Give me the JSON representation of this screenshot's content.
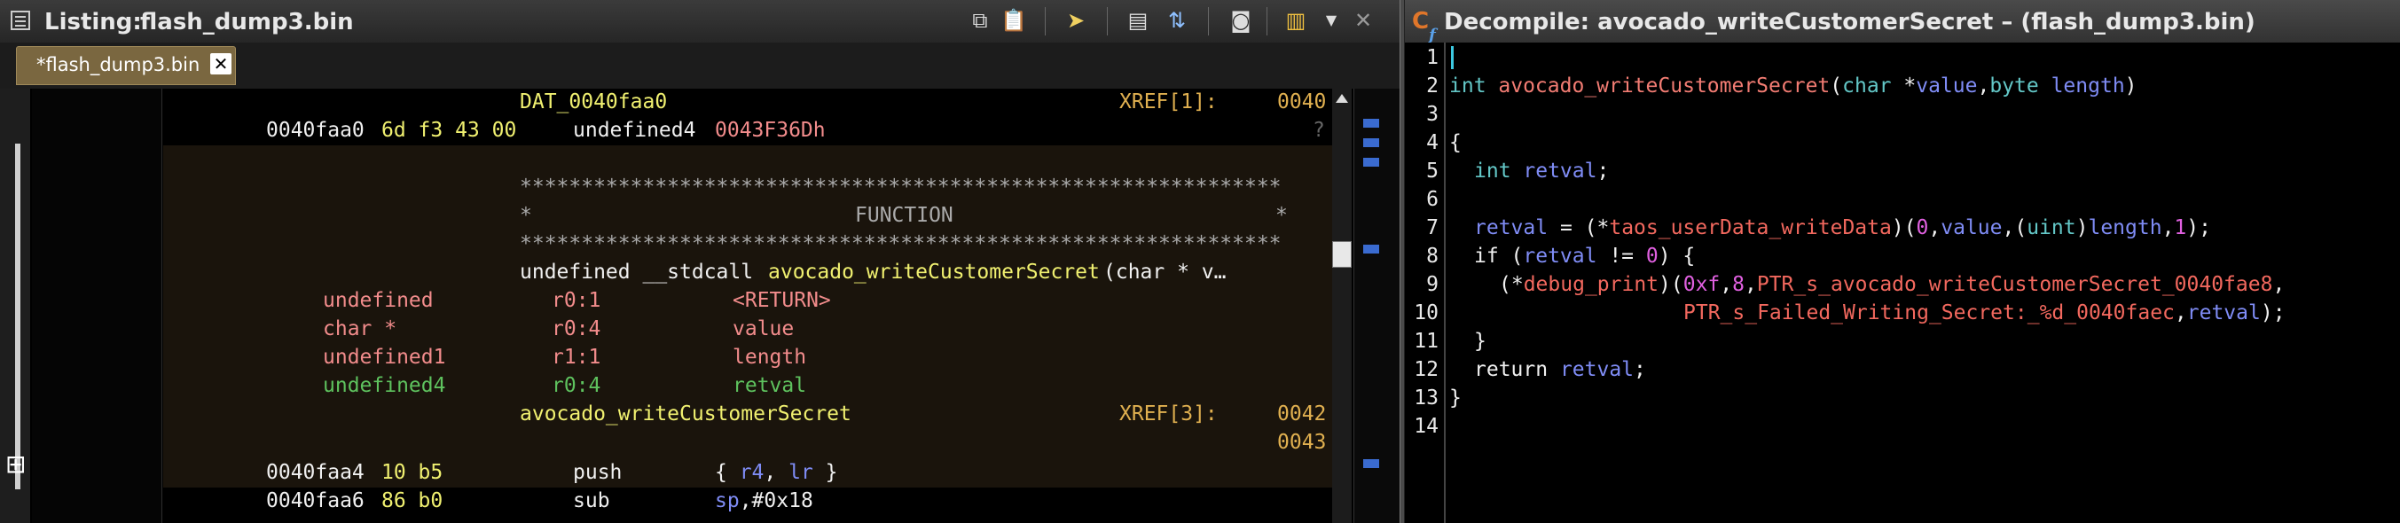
{
  "listing": {
    "title_prefix": "Listing:",
    "title_file": "flash_dump3.bin",
    "tab_label": "*flash_dump3.bin",
    "tab_close": "✕",
    "lines": {
      "dat_label": "DAT_0040faa0",
      "xref1_label": "XREF[1]:",
      "xref1_addr": "0040",
      "data_addr": "0040faa0",
      "data_bytes": "6d f3 43 00",
      "data_type": "undefined4",
      "data_value": "0043F36Dh",
      "data_q": "?",
      "stars": "**************************************************************",
      "star": "*",
      "function_word": "FUNCTION",
      "sig_prefix": "undefined __stdcall ",
      "sig_fn": "avocado_writeCustomerSecret",
      "sig_suffix": "(char * v…",
      "params": [
        {
          "type": "undefined",
          "storage": "r0:1",
          "name": "<RETURN>"
        },
        {
          "type": "char *",
          "storage": "r0:4",
          "name": "value"
        },
        {
          "type": "undefined1",
          "storage": "r1:1",
          "name": "length"
        },
        {
          "type": "undefined4",
          "storage": "r0:4",
          "name": "retval"
        }
      ],
      "fn_label": "avocado_writeCustomerSecret",
      "xref3_label": "XREF[3]:",
      "xref3_addr1": "0042",
      "xref3_addr2": "0043",
      "ins1_addr": "0040faa4",
      "ins1_bytes": "10 b5",
      "ins1_mnem": "push",
      "ins1_ops_a": "{ ",
      "ins1_ops_r4": "r4",
      "ins1_ops_sep": ", ",
      "ins1_ops_lr": "lr",
      "ins1_ops_b": " }",
      "ins2_addr": "0040faa6",
      "ins2_bytes": "86 b0",
      "ins2_mnem": "sub",
      "ins2_ops_sp": "sp",
      "ins2_ops_imm": ",#0x18"
    }
  },
  "decompile": {
    "title": "Decompile: avocado_writeCustomerSecret –  (flash_dump3.bin)",
    "line_numbers": [
      "1",
      "2",
      "3",
      "4",
      "5",
      "6",
      "7",
      "8",
      "9",
      "10",
      "11",
      "12",
      "13",
      "14"
    ],
    "code": {
      "l2_int": "int ",
      "l2_fn": "avocado_writeCustomerSecret",
      "l2_open": "(",
      "l2_char": "char",
      "l2_star": " *",
      "l2_value": "value",
      "l2_comma": ",",
      "l2_byte": "byte",
      "l2_sp": " ",
      "l2_length": "length",
      "l2_close": ")",
      "l4": "{",
      "l5_int": "int ",
      "l5_retval": "retval",
      "l5_semi": ";",
      "l7_retval": "retval",
      "l7_eq": " = (*",
      "l7_global": "taos_userData_writeData",
      "l7_p1": ")(",
      "l7_zero": "0",
      "l7_c1": ",",
      "l7_value": "value",
      "l7_c2": ",(",
      "l7_uint": "uint",
      "l7_p2": ")",
      "l7_length": "length",
      "l7_c3": ",",
      "l7_one": "1",
      "l7_end": ");",
      "l8_if": "if (",
      "l8_retval": "retval",
      "l8_ne": " != ",
      "l8_zero": "0",
      "l8_end": ") {",
      "l9_open": "(*",
      "l9_fn": "debug_print",
      "l9_p": ")(",
      "l9_0xf": "0xf",
      "l9_c1": ",",
      "l9_8": "8",
      "l9_c2": ",",
      "l9_ptr": "PTR_s_avocado_writeCustomerSecret_0040fae8",
      "l9_c3": ",",
      "l10_ptr": "PTR_s_Failed_Writing_Secret:_%d_0040faec",
      "l10_c": ",",
      "l10_retval": "retval",
      "l10_end": ");",
      "l11": "}",
      "l12_ret": "return ",
      "l12_retval": "retval",
      "l12_semi": ";",
      "l13": "}"
    }
  },
  "colors": {
    "listing_tab": "#7a6740",
    "function_band": "#1a140c",
    "address": "#f0f0f0",
    "bytes": "#f0f070",
    "label": "#f0f070",
    "xref": "#e0b050",
    "param_type": "#f28c8c",
    "param_storage": "#f28c8c",
    "local_type": "#5ec25e"
  },
  "icons": [
    "listing-window-icon",
    "copy-icon",
    "paste-icon",
    "cursor-icon",
    "snapshot-icon",
    "field-icon",
    "camera-icon",
    "layout-icon",
    "dropdown-icon",
    "close-icon",
    "decompile-icon",
    "scroll-up-icon",
    "slider-handle-icon"
  ]
}
